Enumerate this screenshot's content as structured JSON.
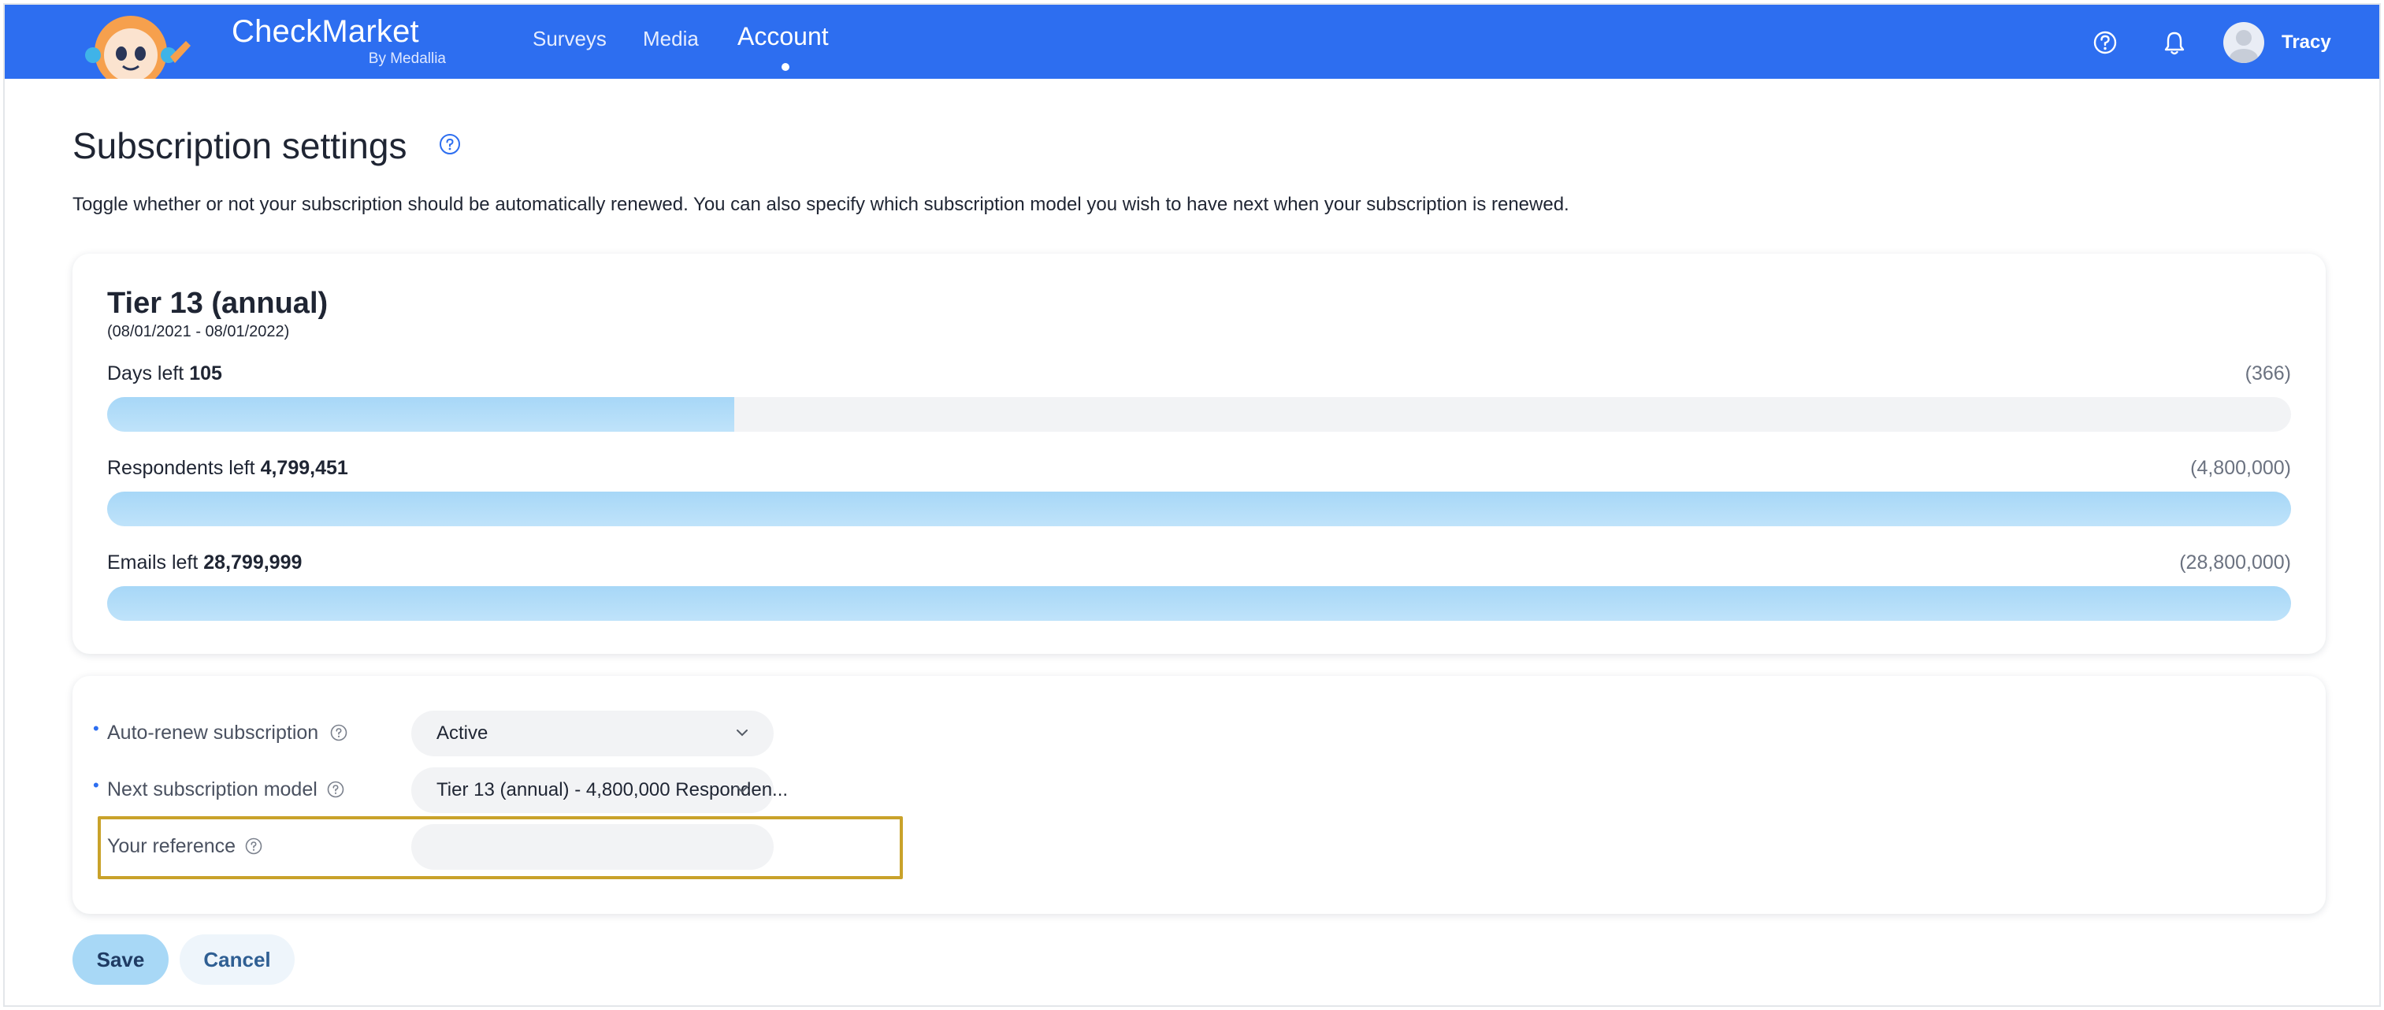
{
  "header": {
    "brand_name": "CheckMarket",
    "brand_sub": "By Medallia",
    "nav": [
      {
        "label": "Surveys"
      },
      {
        "label": "Media"
      },
      {
        "label": "Account",
        "active": true
      }
    ],
    "icons": [
      "help-icon",
      "bell-icon",
      "user-avatar-icon"
    ],
    "user_name": "Tracy",
    "accent_color": "#2d6ef0"
  },
  "page": {
    "title": "Subscription settings",
    "description": "Toggle whether or not your subscription should be automatically renewed. You can also specify which subscription model you wish to have next when your subscription is renewed."
  },
  "subscription": {
    "tier": "Tier 13 (annual)",
    "dates": "(08/01/2021 - 08/01/2022)",
    "meters": [
      {
        "label": "Days left",
        "value_text": "105",
        "total_text": "(366)",
        "fill_fraction": 0.287
      },
      {
        "label": "Respondents left",
        "value_text": "4,799,451",
        "total_text": "(4,800,000)",
        "fill_fraction": 0.9999
      },
      {
        "label": "Emails left",
        "value_text": "28,799,999",
        "total_text": "(28,800,000)",
        "fill_fraction": 1.0
      }
    ]
  },
  "form": {
    "auto_renew": {
      "label": "Auto-renew subscription",
      "value": "Active",
      "required": true
    },
    "next_model": {
      "label": "Next subscription model",
      "value": "Tier 13 (annual) - 4,800,000 Responden...",
      "required": true
    },
    "reference": {
      "label": "Your reference",
      "value": "",
      "placeholder": ""
    }
  },
  "actions": {
    "save_label": "Save",
    "cancel_label": "Cancel"
  }
}
